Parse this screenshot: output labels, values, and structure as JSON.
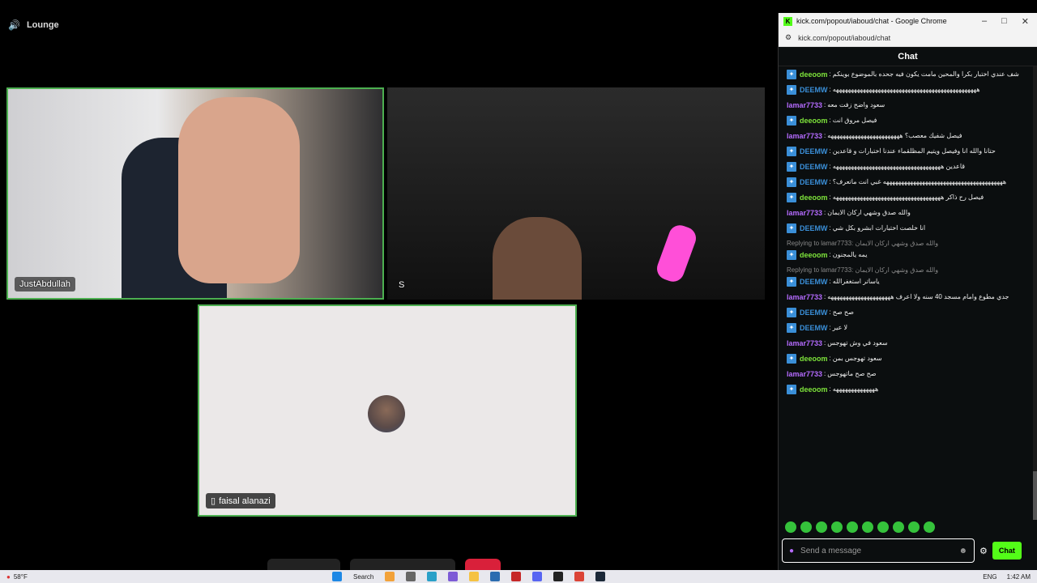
{
  "channel": {
    "name": "Lounge"
  },
  "tiles": [
    {
      "name": "JustAbdullah"
    },
    {
      "name": "S"
    },
    {
      "name": "faisal alanazi"
    }
  ],
  "chat_window": {
    "title": "kick.com/popout/iaboud/chat - Google Chrome",
    "url": "kick.com/popout/iaboud/chat",
    "header": "Chat",
    "messages": [
      {
        "user": "deeoom",
        "color": "#7ee43b",
        "badge": true,
        "text": "شف عندي اختبار بكرا والمحين مامت يكون فيه جحده بالموضوع بوينكم"
      },
      {
        "user": "DEEMW",
        "color": "#3a8fd8",
        "badge": true,
        "text": "ههههههههههههههههههههههههههههههههههههههههههههههههه"
      },
      {
        "user": "lamar7733",
        "color": "#b56bff",
        "badge": false,
        "text": "سعود واضح زفت معه"
      },
      {
        "user": "deeoom",
        "color": "#7ee43b",
        "badge": true,
        "text": "فيصل مروق انت"
      },
      {
        "user": "lamar7733",
        "color": "#b56bff",
        "badge": false,
        "text": "فيصل شفيك معصب؟ ههههههههههههههههههههههههه"
      },
      {
        "user": "DEEMW",
        "color": "#3a8fd8",
        "badge": true,
        "text": "حتانا والله انا وفيصل ويتيم المظلقماء عندنا اختبارات و قاعدين"
      },
      {
        "user": "DEEMW",
        "color": "#3a8fd8",
        "badge": true,
        "text": "قاعدين ههههههههههههههههههههههههههههههههههههه"
      },
      {
        "user": "DEEMW",
        "color": "#3a8fd8",
        "badge": true,
        "text": "ههههههههههههههههههههههههههههههههههههههههه غبي انت ماتعرف؟"
      },
      {
        "user": "deeoom",
        "color": "#7ee43b",
        "badge": true,
        "text": "فيصل رح ذاكر ههههههههههههههههههههههههههههههههههههه"
      },
      {
        "user": "lamar7733",
        "color": "#b56bff",
        "badge": false,
        "text": "والله صدق وشهي اركان الايمان"
      },
      {
        "user": "DEEMW",
        "color": "#3a8fd8",
        "badge": true,
        "text": "انا خلصت اختبارات ابشرو بكل شي"
      },
      {
        "user": "deeoom",
        "color": "#7ee43b",
        "badge": true,
        "reply": "Replying to lamar7733: والله صدق وشهي اركان الايمان",
        "text": "يمه يالمجنون"
      },
      {
        "user": "DEEMW",
        "color": "#3a8fd8",
        "badge": true,
        "reply": "Replying to lamar7733: والله صدق وشهي اركان الايمان",
        "text": "ياساتر استغفرالله"
      },
      {
        "user": "lamar7733",
        "color": "#b56bff",
        "badge": false,
        "text": "جدي مطوع وامام مسجد 40 سنه ولا اعرف هههههههههههههههههههههه"
      },
      {
        "user": "DEEMW",
        "color": "#3a8fd8",
        "badge": true,
        "text": "صح صح"
      },
      {
        "user": "DEEMW",
        "color": "#3a8fd8",
        "badge": true,
        "text": "لا عير"
      },
      {
        "user": "lamar7733",
        "color": "#b56bff",
        "badge": false,
        "text": "سعود في وش تهوجس"
      },
      {
        "user": "deeoom",
        "color": "#7ee43b",
        "badge": true,
        "text": "سعود تهوجس بمن"
      },
      {
        "user": "lamar7733",
        "color": "#b56bff",
        "badge": false,
        "text": "صح صح ماتهوجس"
      },
      {
        "user": "deeoom",
        "color": "#7ee43b",
        "badge": true,
        "text": "ههههههههههههههه"
      }
    ],
    "input_placeholder": "Send a message",
    "send_label": "Chat"
  },
  "taskbar": {
    "weather": "58°F",
    "search": "Search",
    "lang": "ENG",
    "time": "1:42 AM"
  },
  "colors": {
    "accent": "#53fc18",
    "active_border": "#4caf50"
  }
}
